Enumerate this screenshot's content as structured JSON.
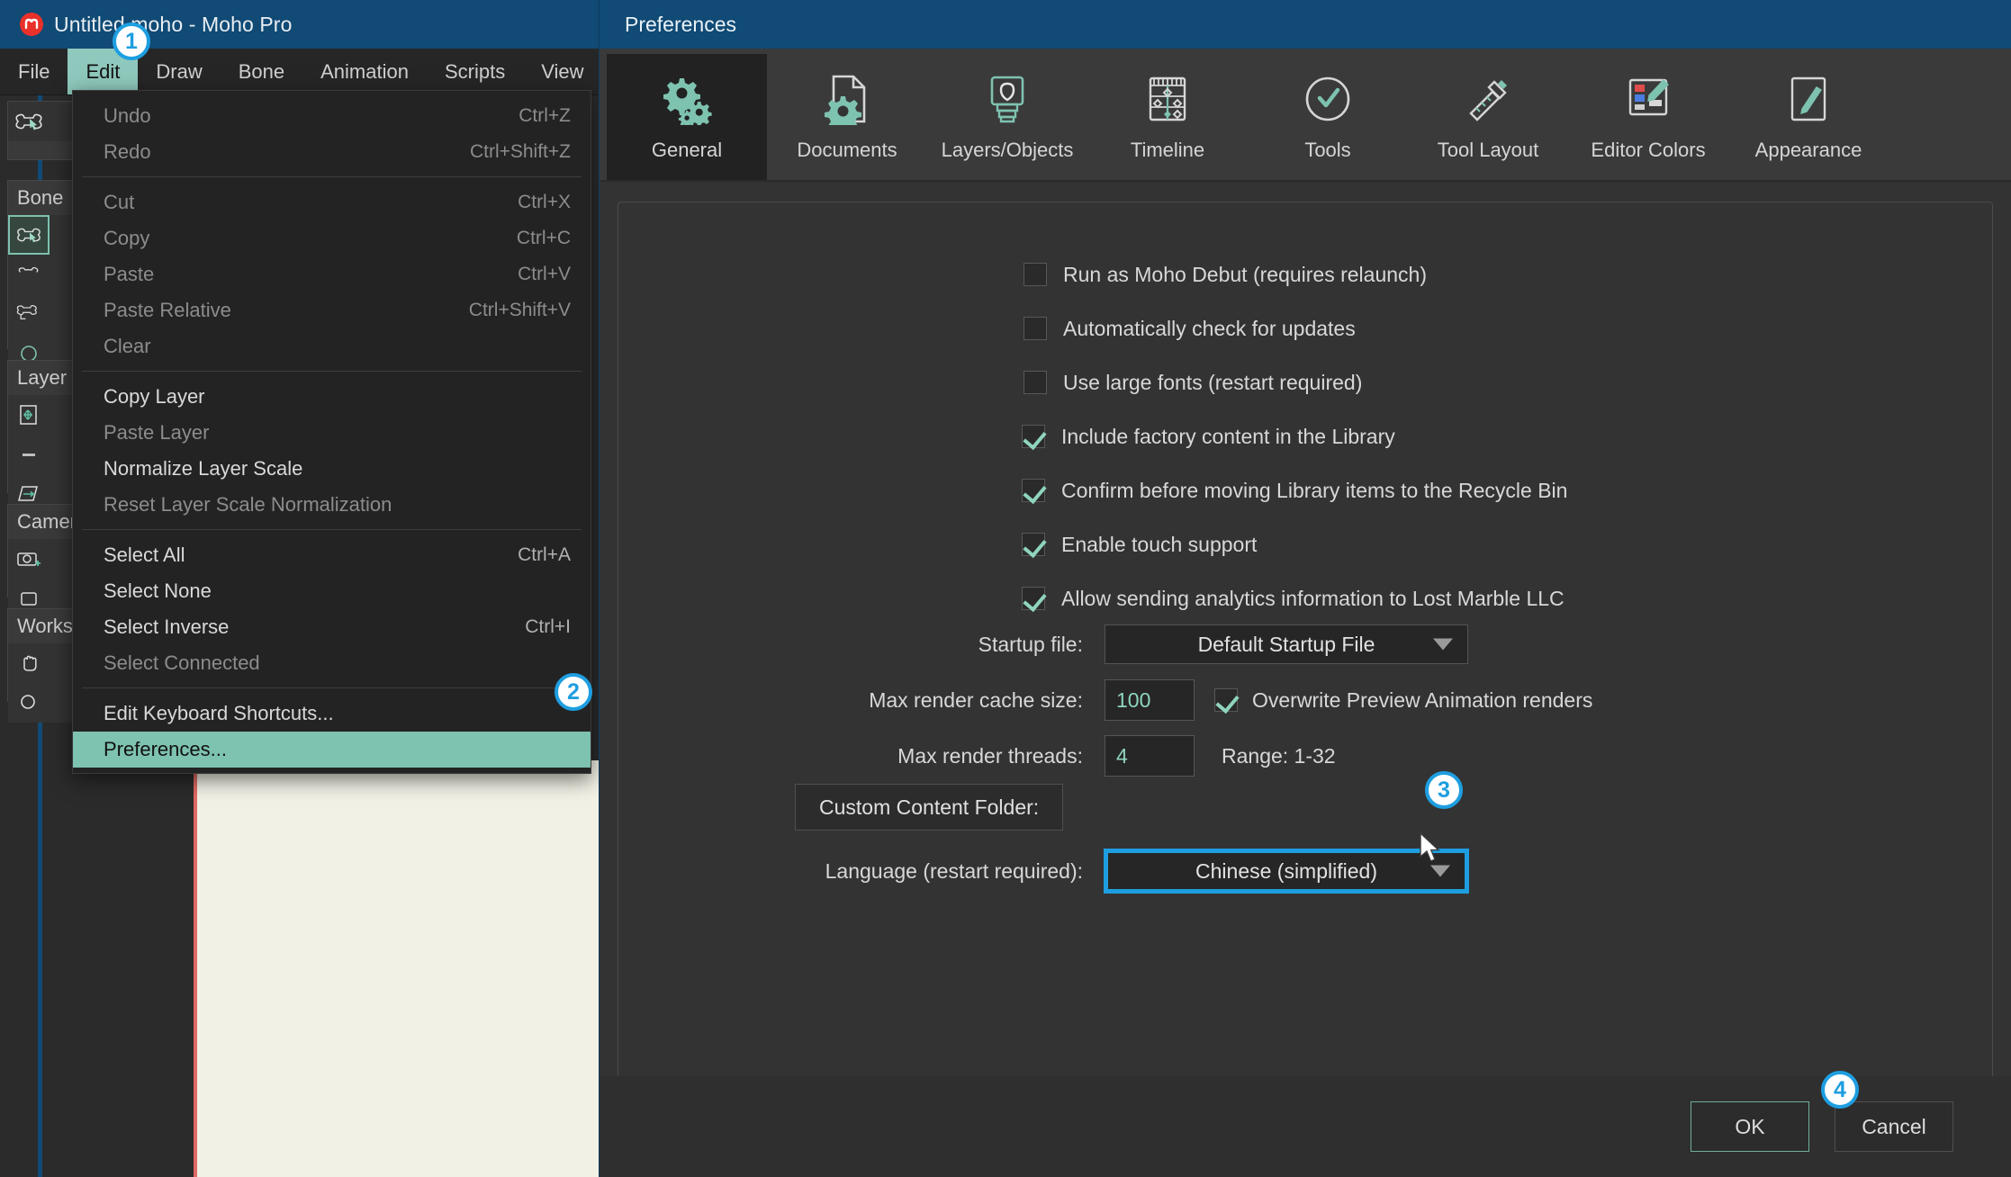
{
  "app": {
    "title": "Untitled.moho - Moho Pro",
    "logo_icon": "moho-logo-icon"
  },
  "menubar": {
    "items": [
      {
        "label": "File",
        "active": false
      },
      {
        "label": "Edit",
        "active": true
      },
      {
        "label": "Draw",
        "active": false
      },
      {
        "label": "Bone",
        "active": false
      },
      {
        "label": "Animation",
        "active": false
      },
      {
        "label": "Scripts",
        "active": false
      },
      {
        "label": "View",
        "active": false
      }
    ]
  },
  "edit_menu": {
    "items": [
      {
        "label": "Undo",
        "accel": "Ctrl+Z",
        "disabled": true,
        "sep_after": false
      },
      {
        "label": "Redo",
        "accel": "Ctrl+Shift+Z",
        "disabled": true,
        "sep_after": true
      },
      {
        "label": "Cut",
        "accel": "Ctrl+X",
        "disabled": true,
        "sep_after": false
      },
      {
        "label": "Copy",
        "accel": "Ctrl+C",
        "disabled": true,
        "sep_after": false
      },
      {
        "label": "Paste",
        "accel": "Ctrl+V",
        "disabled": true,
        "sep_after": false
      },
      {
        "label": "Paste Relative",
        "accel": "Ctrl+Shift+V",
        "disabled": true,
        "sep_after": false
      },
      {
        "label": "Clear",
        "accel": "",
        "disabled": true,
        "sep_after": true
      },
      {
        "label": "Copy Layer",
        "accel": "",
        "disabled": false,
        "sep_after": false
      },
      {
        "label": "Paste Layer",
        "accel": "",
        "disabled": true,
        "sep_after": false
      },
      {
        "label": "Normalize Layer Scale",
        "accel": "",
        "disabled": false,
        "sep_after": false
      },
      {
        "label": "Reset Layer Scale Normalization",
        "accel": "",
        "disabled": true,
        "sep_after": true
      },
      {
        "label": "Select All",
        "accel": "Ctrl+A",
        "disabled": false,
        "sep_after": false
      },
      {
        "label": "Select None",
        "accel": "",
        "disabled": false,
        "sep_after": false
      },
      {
        "label": "Select Inverse",
        "accel": "Ctrl+I",
        "disabled": false,
        "sep_after": false
      },
      {
        "label": "Select Connected",
        "accel": "",
        "disabled": true,
        "sep_after": true
      },
      {
        "label": "Edit Keyboard Shortcuts...",
        "accel": "",
        "disabled": false,
        "sep_after": false
      },
      {
        "label": "Preferences...",
        "accel": "",
        "disabled": false,
        "highlight": true,
        "sep_after": false
      }
    ]
  },
  "toolbars": {
    "groups": [
      {
        "header": "Bone"
      },
      {
        "header": "Layer"
      },
      {
        "header": "Camera"
      },
      {
        "header": "Workspace"
      }
    ]
  },
  "prefs": {
    "title": "Preferences",
    "tabs": [
      {
        "label": "General",
        "icon": "gears-icon",
        "active": true
      },
      {
        "label": "Documents",
        "icon": "document-gear-icon",
        "active": false
      },
      {
        "label": "Layers/Objects",
        "icon": "layers-object-icon",
        "active": false
      },
      {
        "label": "Timeline",
        "icon": "timeline-icon",
        "active": false
      },
      {
        "label": "Tools",
        "icon": "tools-icon",
        "active": false
      },
      {
        "label": "Tool Layout",
        "icon": "tool-layout-icon",
        "active": false
      },
      {
        "label": "Editor Colors",
        "icon": "editor-colors-icon",
        "active": false
      },
      {
        "label": "Appearance",
        "icon": "appearance-icon",
        "active": false
      }
    ],
    "checkboxes": [
      {
        "label": "Run as Moho Debut (requires relaunch)",
        "checked": false
      },
      {
        "label": "Automatically check for updates",
        "checked": false
      },
      {
        "label": "Use large fonts (restart required)",
        "checked": false
      },
      {
        "label": "Include factory content in the Library",
        "checked": true
      },
      {
        "label": "Confirm before moving Library items to the Recycle Bin",
        "checked": true
      },
      {
        "label": "Enable touch support",
        "checked": true
      },
      {
        "label": "Allow sending analytics information to Lost Marble LLC",
        "checked": true
      }
    ],
    "startup": {
      "label": "Startup file:",
      "value": "Default Startup File",
      "caret_icon": "chevron-down-icon"
    },
    "render_cache": {
      "label": "Max render cache size:",
      "value": "100",
      "overwrite_label": "Overwrite Preview Animation renders",
      "overwrite_checked": true
    },
    "render_threads": {
      "label": "Max render threads:",
      "value": "4",
      "range_hint": "Range: 1-32"
    },
    "content_folder": {
      "label": "Custom Content Folder:",
      "path": ""
    },
    "language": {
      "label": "Language (restart required):",
      "value": "Chinese (simplified)",
      "caret_icon": "chevron-down-icon",
      "focus_color": "#1e9ee0"
    },
    "footer": {
      "ok_label": "OK",
      "cancel_label": "Cancel"
    }
  },
  "badges": [
    {
      "number": "1"
    },
    {
      "number": "2"
    },
    {
      "number": "3"
    },
    {
      "number": "4"
    }
  ],
  "colors": {
    "accent": "#1e9ee0",
    "highlight": "#7ec2b0",
    "titlebar": "#104a75",
    "check": "#8fd4be"
  }
}
